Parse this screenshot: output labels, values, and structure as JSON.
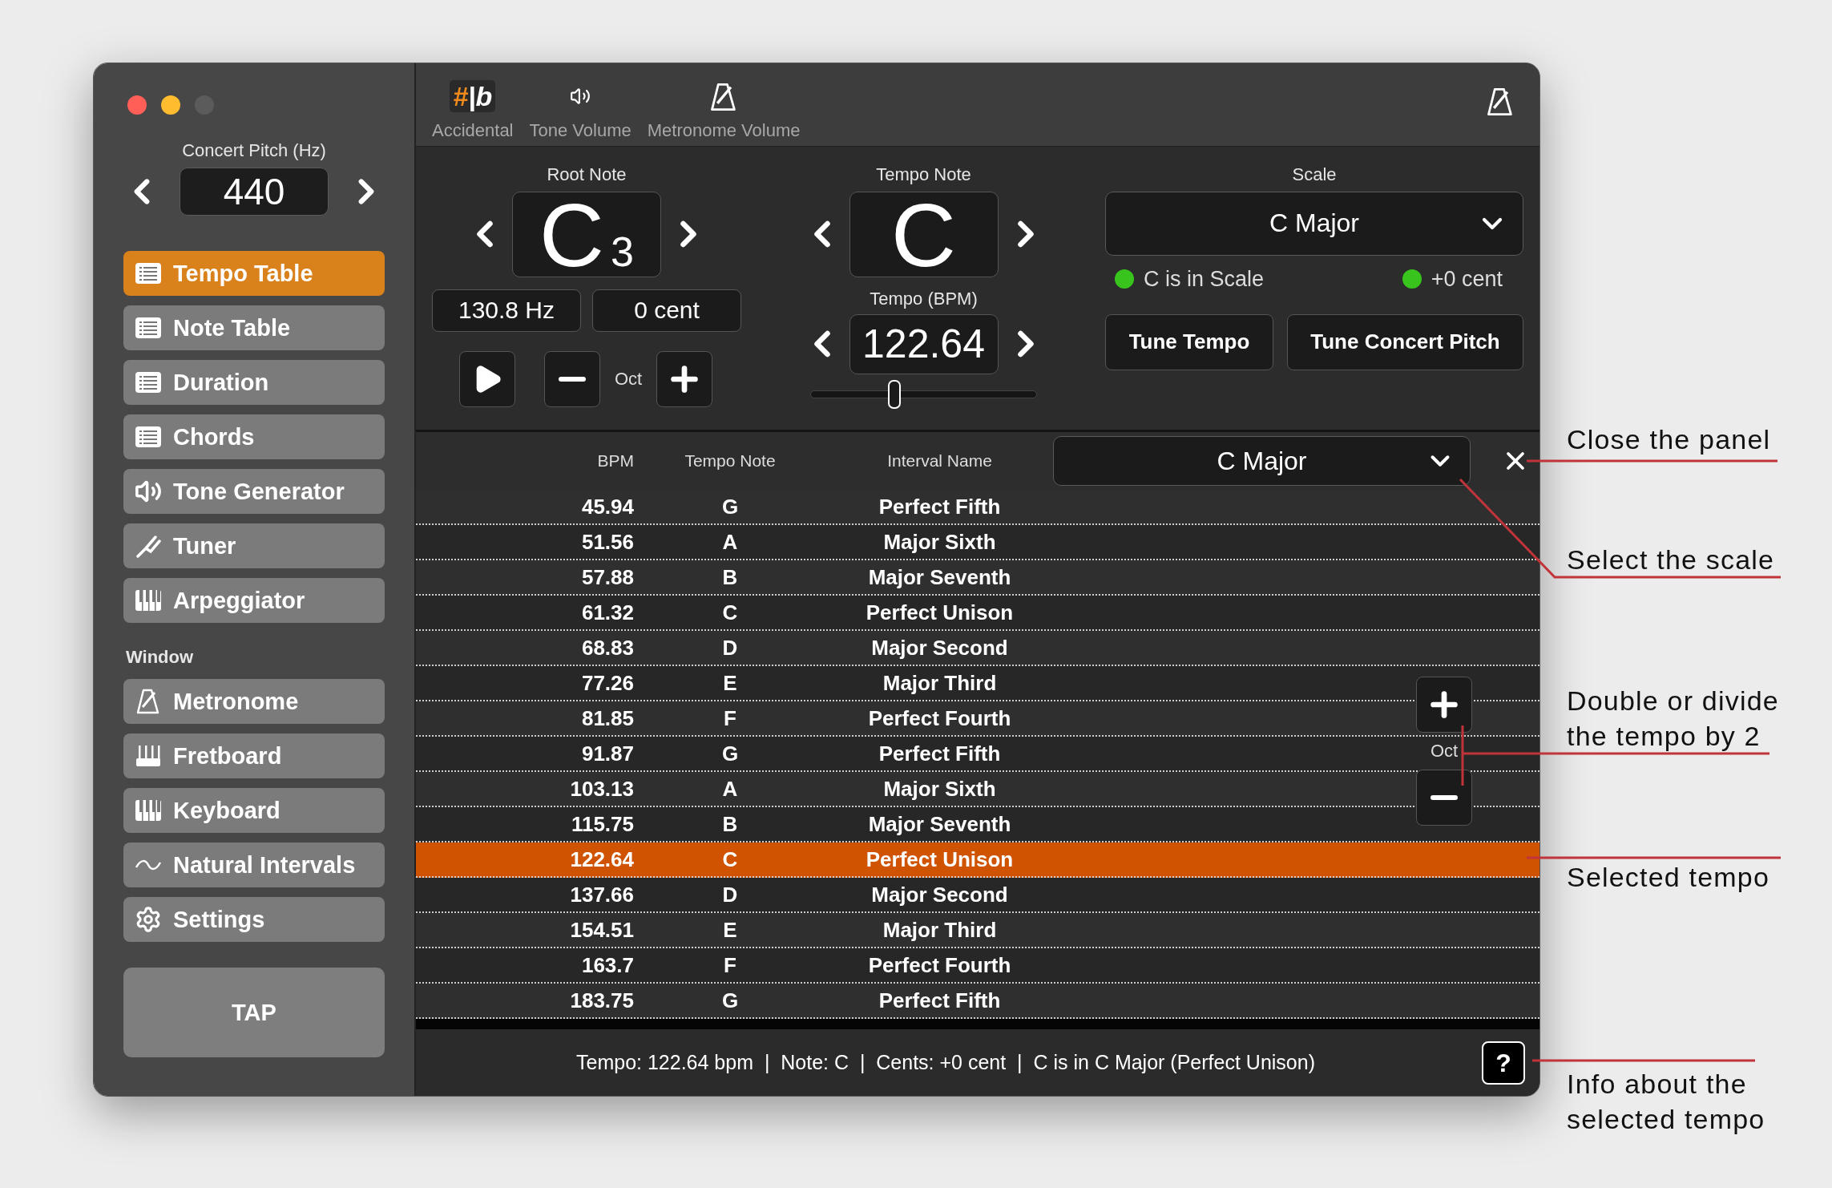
{
  "window": {
    "controls": [
      {
        "color": "#ff5f57"
      },
      {
        "color": "#febc2e"
      },
      {
        "color": "#5b5b5b"
      }
    ]
  },
  "sidebar": {
    "concert_pitch": {
      "label": "Concert Pitch (Hz)",
      "value": "440"
    },
    "items": [
      {
        "label": "Tempo Table",
        "selected": true
      },
      {
        "label": "Note Table",
        "selected": false
      },
      {
        "label": "Duration",
        "selected": false
      },
      {
        "label": "Chords",
        "selected": false
      },
      {
        "label": "Tone Generator",
        "selected": false
      },
      {
        "label": "Tuner",
        "selected": false
      },
      {
        "label": "Arpeggiator",
        "selected": false
      }
    ],
    "section": "Window",
    "window_items": [
      {
        "label": "Metronome",
        "selected": false
      },
      {
        "label": "Fretboard",
        "selected": false
      },
      {
        "label": "Keyboard",
        "selected": false
      },
      {
        "label": "Natural Intervals",
        "selected": false
      },
      {
        "label": "Settings",
        "selected": false
      }
    ],
    "tap": "TAP"
  },
  "toolbar": {
    "accidental": {
      "label": "Accidental",
      "sharp": "#",
      "flat": "|b"
    },
    "tone_volume": {
      "label": "Tone Volume"
    },
    "metronome_volume": {
      "label": "Metronome Volume"
    }
  },
  "controls": {
    "root_note": {
      "label": "Root Note",
      "note": "C",
      "octave": "3",
      "frequency": "130.8 Hz",
      "cents": "0 cent",
      "oct_label": "Oct"
    },
    "tempo_note": {
      "label": "Tempo Note",
      "note": "C"
    },
    "tempo": {
      "label": "Tempo (BPM)",
      "value": "122.64",
      "level": 0.37
    },
    "scale": {
      "label": "Scale",
      "value": "C Major"
    },
    "indicators": [
      {
        "label": "C is in Scale",
        "on": true
      },
      {
        "label": "+0 cent",
        "on": true
      }
    ],
    "buttons": [
      "Tune Tempo",
      "Tune Concert Pitch"
    ]
  },
  "table": {
    "columns": [
      "BPM",
      "Tempo Note",
      "Interval Name"
    ],
    "scale": "C Major",
    "oct_label": "Oct",
    "rows": [
      {
        "bpm": "45.94",
        "note": "G",
        "interval": "Perfect Fifth",
        "selected": false
      },
      {
        "bpm": "51.56",
        "note": "A",
        "interval": "Major Sixth",
        "selected": false
      },
      {
        "bpm": "57.88",
        "note": "B",
        "interval": "Major Seventh",
        "selected": false
      },
      {
        "bpm": "61.32",
        "note": "C",
        "interval": "Perfect Unison",
        "selected": false
      },
      {
        "bpm": "68.83",
        "note": "D",
        "interval": "Major Second",
        "selected": false
      },
      {
        "bpm": "77.26",
        "note": "E",
        "interval": "Major Third",
        "selected": false
      },
      {
        "bpm": "81.85",
        "note": "F",
        "interval": "Perfect Fourth",
        "selected": false
      },
      {
        "bpm": "91.87",
        "note": "G",
        "interval": "Perfect Fifth",
        "selected": false
      },
      {
        "bpm": "103.13",
        "note": "A",
        "interval": "Major Sixth",
        "selected": false
      },
      {
        "bpm": "115.75",
        "note": "B",
        "interval": "Major Seventh",
        "selected": false
      },
      {
        "bpm": "122.64",
        "note": "C",
        "interval": "Perfect Unison",
        "selected": true
      },
      {
        "bpm": "137.66",
        "note": "D",
        "interval": "Major Second",
        "selected": false
      },
      {
        "bpm": "154.51",
        "note": "E",
        "interval": "Major Third",
        "selected": false
      },
      {
        "bpm": "163.7",
        "note": "F",
        "interval": "Perfect Fourth",
        "selected": false
      },
      {
        "bpm": "183.75",
        "note": "G",
        "interval": "Perfect Fifth",
        "selected": false
      }
    ]
  },
  "status_bar": {
    "text": "Tempo: 122.64 bpm  |  Note: C  |  Cents: +0 cent  |  C is in C Major (Perfect Unison)",
    "help": "?"
  },
  "annotations": [
    "Close the panel",
    "Select the scale",
    "Double or divide the tempo by 2",
    "Selected tempo",
    "Info about the selected tempo"
  ]
}
